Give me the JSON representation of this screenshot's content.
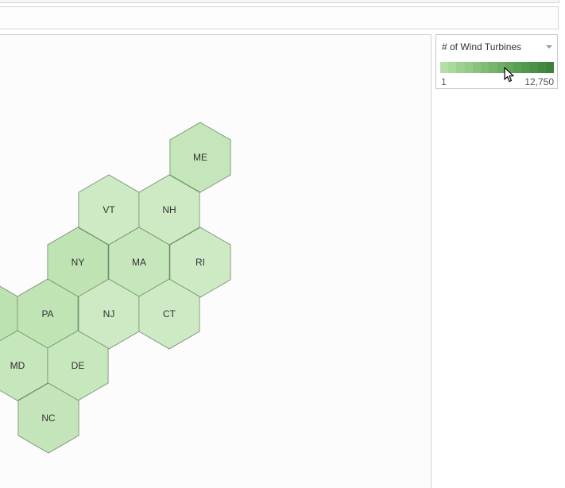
{
  "legend": {
    "title": "# of Wind Turbines",
    "min_label": "1",
    "max_label": "12,750",
    "ramp_colors": [
      "#b3dea6",
      "#a8d99a",
      "#9dd08f",
      "#94cb87",
      "#89c47d",
      "#80bd74",
      "#76b66b",
      "#6cae63",
      "#63a65b",
      "#599f53",
      "#519a4d",
      "#4a9147",
      "#438a41",
      "#3d823c"
    ]
  },
  "map": {
    "states": [
      {
        "abbr": "ME",
        "fill": "#c5e6ba"
      },
      {
        "abbr": "VT",
        "fill": "#cdeac4"
      },
      {
        "abbr": "NH",
        "fill": "#cdeac4"
      },
      {
        "abbr": "NY",
        "fill": "#bfe3b3"
      },
      {
        "abbr": "MA",
        "fill": "#c6e7bc"
      },
      {
        "abbr": "RI",
        "fill": "#cdeac4"
      },
      {
        "abbr": "",
        "fill": "#bde2b1"
      },
      {
        "abbr": "PA",
        "fill": "#c1e4b5"
      },
      {
        "abbr": "NJ",
        "fill": "#cdeac4"
      },
      {
        "abbr": "CT",
        "fill": "#cdeac4"
      },
      {
        "abbr": "MD",
        "fill": "#c6e7bc"
      },
      {
        "abbr": "DE",
        "fill": "#c7e8bd"
      },
      {
        "abbr": "NC",
        "fill": "#c4e5b9"
      }
    ]
  }
}
